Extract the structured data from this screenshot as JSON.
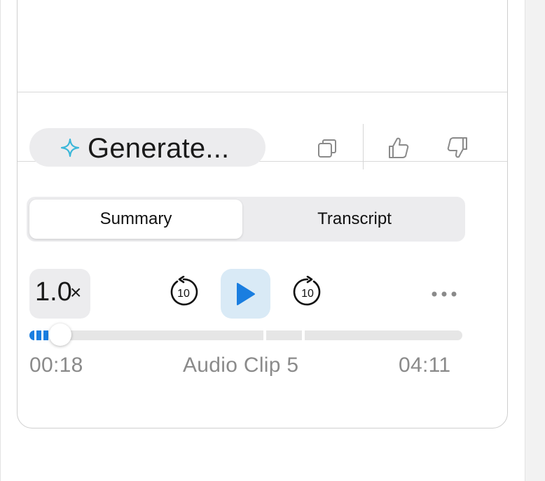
{
  "toolbar": {
    "generate_label": "Generate...",
    "icons": [
      "sparkle-icon",
      "copy-icon",
      "thumbs-up-icon",
      "thumbs-down-icon"
    ]
  },
  "tabs": {
    "items": [
      {
        "label": "Summary",
        "active": true
      },
      {
        "label": "Transcript",
        "active": false
      }
    ]
  },
  "player": {
    "speed_value": "1.0",
    "speed_suffix": "×",
    "skip_back_seconds": "10",
    "skip_forward_seconds": "10",
    "current_time": "00:18",
    "clip_title": "Audio Clip 5",
    "duration": "04:11",
    "progress_fraction": 0.072,
    "segment_marks_fraction": [
      0.544,
      0.632
    ],
    "buffered_fraction": 0.072
  },
  "colors": {
    "accent": "#1a7ee0",
    "play_bg": "#d9eaf6",
    "sparkle": "#3bb7d9",
    "pill_bg": "#ececee",
    "muted_text": "#8a8a8a"
  }
}
